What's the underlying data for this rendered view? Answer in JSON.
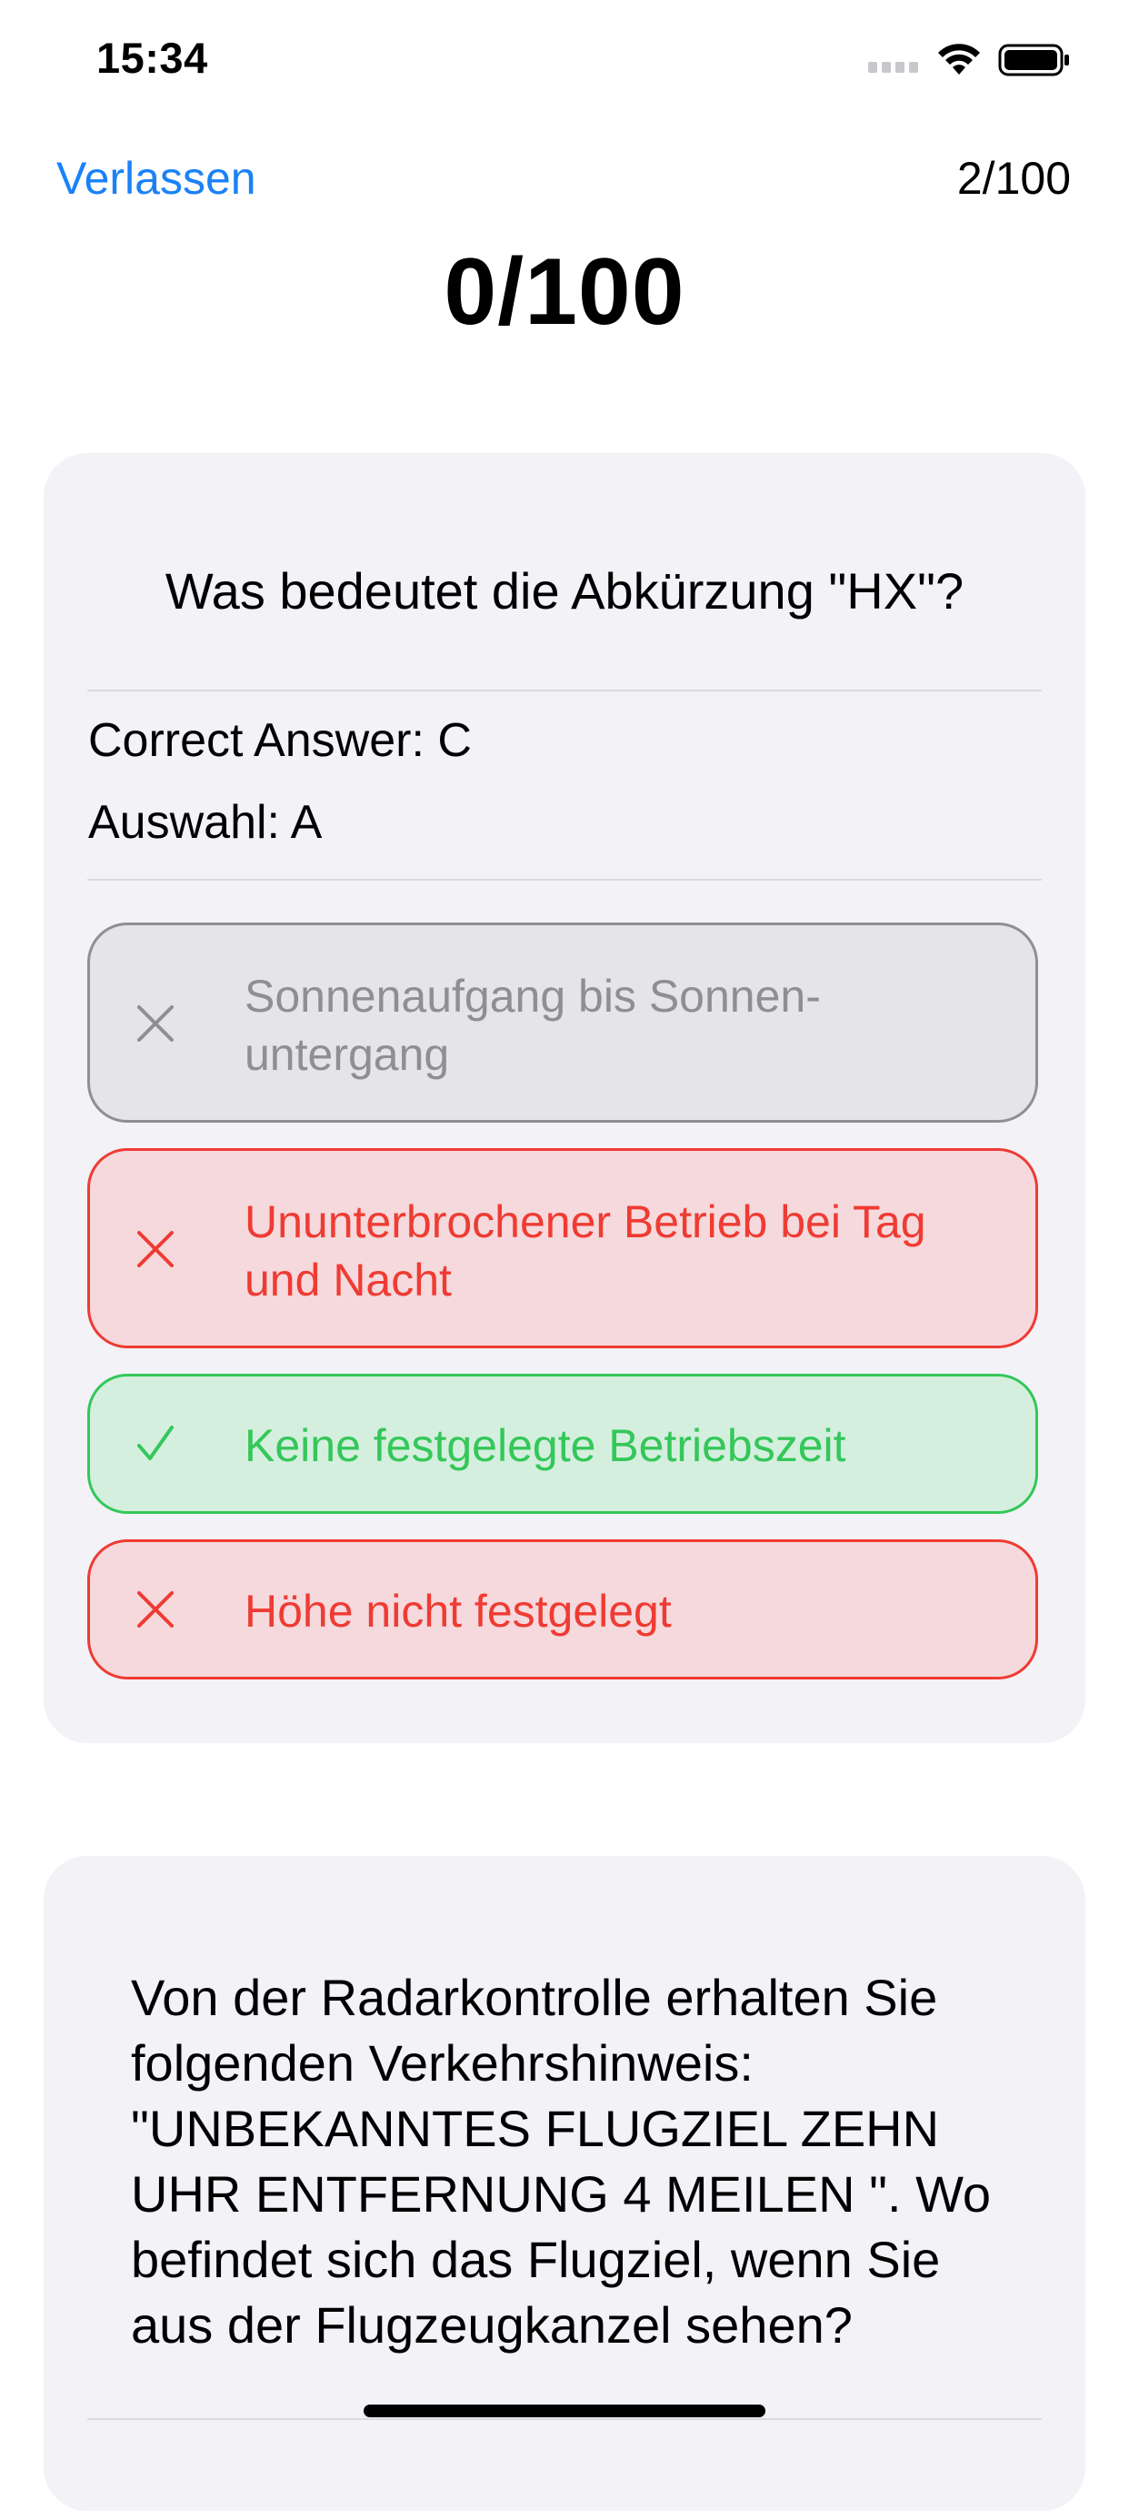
{
  "status_bar": {
    "time": "15:34"
  },
  "nav": {
    "leave_label": "Verlassen",
    "progress": "2/100"
  },
  "score": "0/100",
  "card1": {
    "question": "Was bedeutet die Abkürzung \"HX\"?",
    "correct_answer": "Correct Answer: C",
    "selection": "Auswahl: A",
    "options": [
      {
        "text": "Sonnenaufgang bis Sonnen-untergang",
        "state": "neutral",
        "icon": "x-mark-icon"
      },
      {
        "text": "Ununterbrochener Betrieb bei Tag und Nacht",
        "state": "wrong",
        "icon": "x-mark-icon"
      },
      {
        "text": "Keine festgelegte Betriebszeit",
        "state": "correct",
        "icon": "checkmark-icon"
      },
      {
        "text": "Höhe nicht festgelegt",
        "state": "wrong",
        "icon": "x-mark-icon"
      }
    ]
  },
  "card2": {
    "question": "Von der Radarkontrolle erhalten Sie folgenden Verkehrshinweis: \"UNBEKANNTES FLUGZIEL ZEHN UHR ENTFERNUNG 4 MEILEN \". Wo befindet sich das Flugziel, wenn Sie aus der Flugzeugkanzel sehen?"
  },
  "colors": {
    "accent": "#1a82f7",
    "wrong": "#ef3b33",
    "correct": "#34c759",
    "neutral": "#8e8e93",
    "card_bg": "#f2f2f7"
  }
}
